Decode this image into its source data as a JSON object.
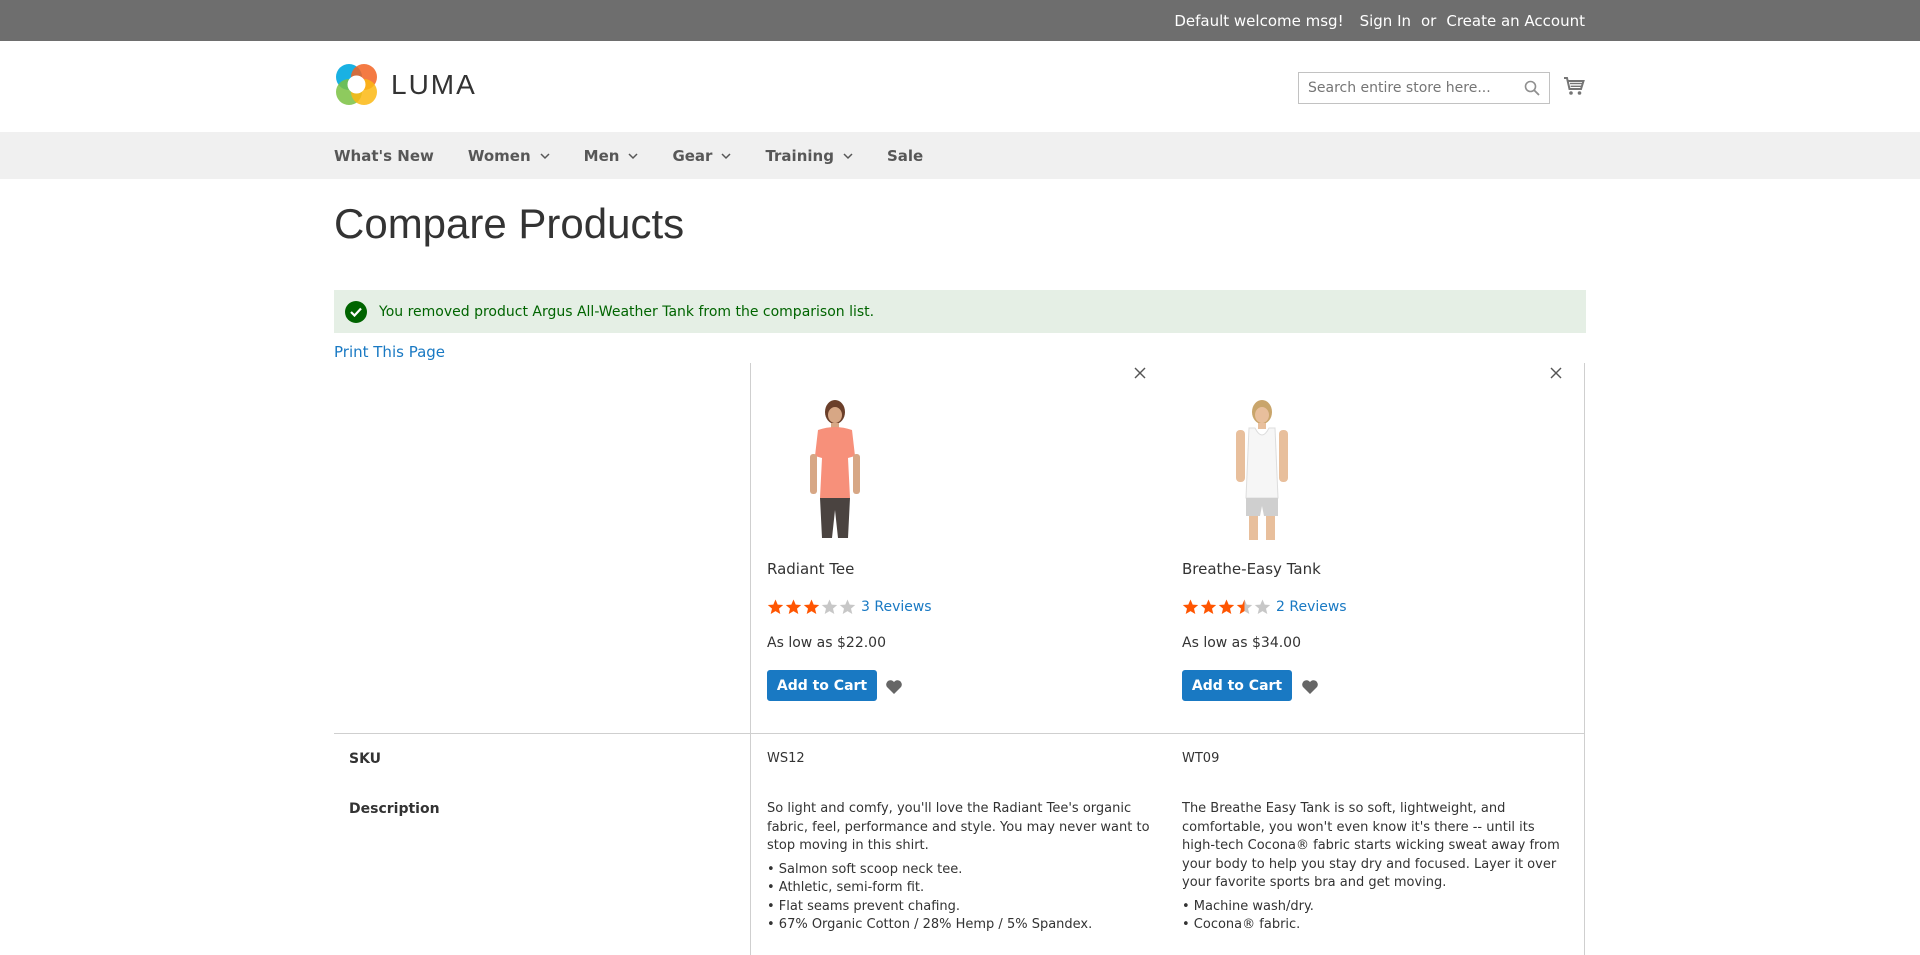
{
  "topbar": {
    "welcome": "Default welcome msg!",
    "sign_in": "Sign In",
    "or": "or",
    "create_account": "Create an Account"
  },
  "header": {
    "logo_text": "LUMA",
    "search_placeholder": "Search entire store here...",
    "search_icon": "search-icon",
    "cart_icon": "cart-icon"
  },
  "nav": {
    "items": [
      {
        "label": "What's New",
        "has_dropdown": false
      },
      {
        "label": "Women",
        "has_dropdown": true
      },
      {
        "label": "Men",
        "has_dropdown": true
      },
      {
        "label": "Gear",
        "has_dropdown": true
      },
      {
        "label": "Training",
        "has_dropdown": true
      },
      {
        "label": "Sale",
        "has_dropdown": false
      }
    ]
  },
  "page": {
    "title": "Compare Products",
    "message": "You removed product Argus All-Weather Tank from the comparison list.",
    "print_link": "Print This Page"
  },
  "colors": {
    "accent": "#1979c3",
    "star": "#ff5501",
    "success_bg": "#e5efe5",
    "success_text": "#006400"
  },
  "products": [
    {
      "name": "Radiant Tee",
      "rating_stars": 3,
      "reviews": "3 Reviews",
      "price": "As low as $22.00",
      "add_to_cart": "Add to Cart",
      "sku": "WS12",
      "description": "So light and comfy, you'll love the Radiant Tee's organic fabric, feel, performance and style. You may never want to stop moving in this shirt.",
      "features": [
        "• Salmon soft scoop neck tee.",
        "• Athletic, semi-form fit.",
        "• Flat seams prevent chafing.",
        "• 67% Organic Cotton / 28% Hemp / 5% Spandex."
      ]
    },
    {
      "name": "Breathe-Easy Tank",
      "rating_stars": 3.5,
      "reviews": "2 Reviews",
      "price": "As low as $34.00",
      "add_to_cart": "Add to Cart",
      "sku": "WT09",
      "description": "The Breathe Easy Tank is so soft, lightweight, and comfortable, you won't even know it's there -- until its high-tech Cocona® fabric starts wicking sweat away from your body to help you stay dry and focused. Layer it over your favorite sports bra and get moving.",
      "features": [
        "• Machine wash/dry.",
        "• Cocona® fabric."
      ]
    }
  ],
  "attributes": {
    "sku_label": "SKU",
    "description_label": "Description"
  }
}
